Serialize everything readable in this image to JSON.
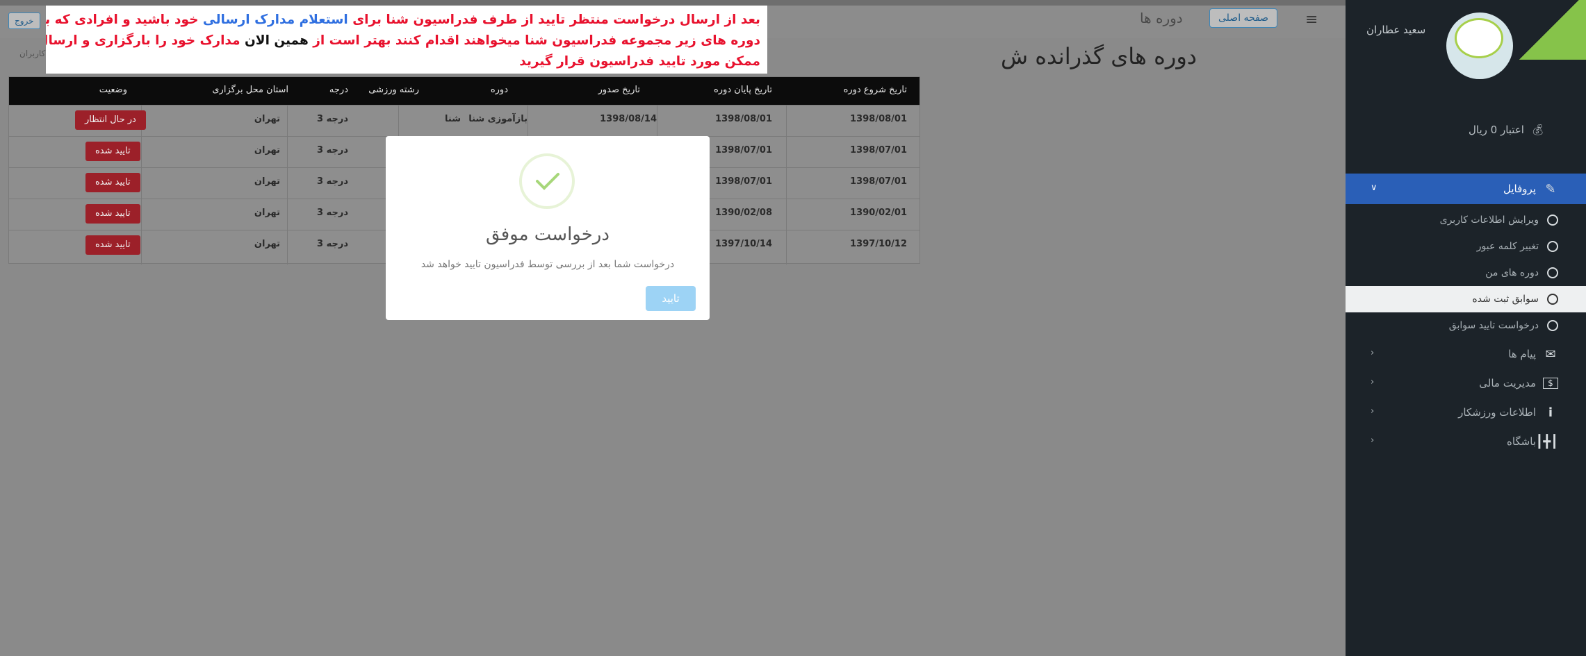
{
  "topbar": {
    "home_label": "صفحه اصلی",
    "courses_label": "دوره ها",
    "exit_label": "خروج"
  },
  "page": {
    "title": "دوره های گذرانده ش",
    "breadcrumb_users": "کاربران"
  },
  "notice": {
    "line1_a": "بعد از ارسال درخواست منتظر تایید از طرف فدراسیون شنا برای ",
    "line1_b": "استعلام مدارک ارسالی",
    "line1_c": " خود باشید و افرادی که برای ارتقا  مدارک هر دوره از",
    "line2_a": "دوره های زیر مجموعه فدراسیون شنا میخواهند اقدام کنند بهتر است از ",
    "line2_b": "همین الان",
    "line2_c": " مدارک خود را بارگزاری و ارسال کنند تا در کوتاه ترین زمان",
    "line3": "ممکن مورد تایید فدراسیون قرار گیرید"
  },
  "sidebar": {
    "user_name": "سعید عطاران",
    "credit": "اعتبار 0 ریال",
    "profile": "پروفایل",
    "sub_items": [
      "ویرایش اطلاعات کاربری",
      "تغییر کلمه عبور",
      "دوره های من",
      "سوابق ثبت شده",
      "درخواست تایید سوابق"
    ],
    "items": [
      "پیام ها",
      "مدیریت مالی",
      "اطلاعات ورزشکار",
      "باشگاه"
    ]
  },
  "table": {
    "headers": [
      "تاریخ شروع دوره",
      "تاریخ پایان دوره",
      "تاریخ صدور",
      "دوره",
      "رشته ورزشی",
      "درجه",
      "استان محل برگزاری",
      "وضعیت"
    ],
    "rows": [
      {
        "start": "1398/08/01",
        "end": "1398/08/01",
        "issued": "1398/08/14",
        "course": "بازآموزی شنا",
        "sport": "شنا",
        "grade": "درجه 3",
        "province": "تهران",
        "status": "در حال انتظار"
      },
      {
        "start": "1398/07/01",
        "end": "1398/07/01",
        "issued": "",
        "course": "",
        "sport": "",
        "grade": "درجه 3",
        "province": "تهران",
        "status": "تایید شده"
      },
      {
        "start": "1398/07/01",
        "end": "1398/07/01",
        "issued": "",
        "course": "",
        "sport": "",
        "grade": "درجه 3",
        "province": "تهران",
        "status": "تایید شده"
      },
      {
        "start": "1390/02/01",
        "end": "1390/02/08",
        "issued": "",
        "course": "",
        "sport": "",
        "grade": "درجه 3",
        "province": "تهران",
        "status": "تایید شده"
      },
      {
        "start": "1397/10/12",
        "end": "1397/10/14",
        "issued": "",
        "course": "",
        "sport": "",
        "grade": "درجه 3",
        "province": "تهران",
        "status": "تایید شده"
      }
    ]
  },
  "modal": {
    "title": "درخواست موفق",
    "text": "درخواست شما بعد از بررسی توسط فدراسیون تایید خواهد شد",
    "ok_label": "تایید"
  },
  "icons": {
    "hamburger": "menu-icon",
    "credit": "coins-icon",
    "profile": "edit-icon",
    "messages": "envelope-icon",
    "finance": "money-icon",
    "athlete": "info-icon",
    "club": "dumbbell-icon",
    "success": "check-icon"
  },
  "colors": {
    "sidebar_bg": "#1c2329",
    "sidebar_active": "#2a5fb7",
    "notice_red": "#e8112d",
    "notice_blue": "#2f6fe0",
    "badge": "#9c2029",
    "ok_button": "#9dd3f5",
    "success_check": "#a7d77a"
  }
}
